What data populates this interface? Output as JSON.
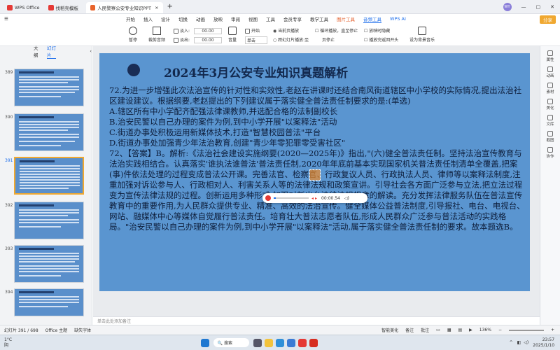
{
  "titlebar": {
    "tabs": [
      {
        "label": "WPS Office",
        "icon": "wps-logo-icon",
        "color": "#e53935"
      },
      {
        "label": "找稻壳模板",
        "icon": "docer-icon",
        "color": "#e53935"
      },
      {
        "label": "人民警察公安专业知识PPT1.p",
        "icon": "ppt-icon",
        "color": "#e8632b"
      }
    ],
    "user_initial": "WY"
  },
  "menubar": {
    "items": [
      "开始",
      "插入",
      "设计",
      "切换",
      "动画",
      "放映",
      "审阅",
      "视图",
      "工具",
      "会员专享",
      "教学工具",
      "图片工具",
      "音频工具"
    ],
    "selected": "音频工具",
    "wps_ai": "WPS AI",
    "share": "分享"
  },
  "ribbon": {
    "play": "播放",
    "pause": "暂停",
    "trim": "裁剪音频",
    "fade_in_label": "淡入:",
    "fade_in_value": "00.00",
    "fade_out_label": "淡出:",
    "fade_out_value": "00.00",
    "volume": "音量",
    "start_label": "开始",
    "start_value": "单击",
    "current_page": "当前页播放",
    "cross_slide": "跨幻灯片播放:至",
    "page_suffix": "页停止",
    "loop": "循环播放，直至停止",
    "hide_icon": "放映时隐藏",
    "rewind": "播放完返回开头",
    "bg_music": "设为背景音乐"
  },
  "sidebar": {
    "tabs": [
      "大纲",
      "幻灯片"
    ],
    "selected_tab": "幻灯片",
    "slides": [
      {
        "num": "389"
      },
      {
        "num": "390"
      },
      {
        "num": "391",
        "current": true
      },
      {
        "num": "392"
      },
      {
        "num": "393"
      },
      {
        "num": "394"
      }
    ]
  },
  "slide": {
    "title": "2024年3月公安专业知识真题解析",
    "lines": [
      "72.为进一步增强此次法治宣传的针对性和实效性,老赵在讲课时还结合南风街道辖区中小学校的实际情况,提出法治社区建设建议。根据纲要,老赵提出的下列建议属于落实健全普法责任制要求的是:(单选)",
      "A.辖区所有中小学配齐配强法律课教师,并选配合格的法制副校长",
      "B.治安民警以自己办理的案件为例,到中小学开展\"以案释法\"活动",
      "C.街道办事处积极运用新媒体技术,打造\"智慧校园普法\"平台",
      "D.街道办事处加强青少年法治教育,创建\"青少年零犯罪零受害社区\"",
      "72、【答案】B。解析:《法治社会建设实施纲要(2020—2025年)》指出,\"(六)健全普法责任制。坚持法治宣传教育与法治实践相结合。认真落实'谁执法谁普法'普法责任制,2020年年底前基本实现国家机关普法责任制清单全覆盖,把案(事)件依法处理的过程变成普法公开课。完善法官、检察官、行政复议人员、行政执法人员、律师等以案释法制度,注重加强对诉讼参与人、行政相对人、利害关系人等的法律法规和政策宣讲。引导社会各方面广泛参与立法,把立法过程变为宣传法律法规的过程。创新运用多种形式,加强对新出台法律法规规章的解读。充分发挥法律服务队伍在普法宣传教育中的重要作用,为人民群众提供专业、精准、高效的法治宣传。健全媒体公益普法制度,引导报社、电台、电视台、网站、融媒体中心等媒体自觉履行普法责任。培育壮大普法志愿者队伍,形成人民群众广泛参与普法活动的实践格局。\"治安民警以自己办理的案件为例,到中小学开展\"以案释法\"活动,属于落实健全普法责任制的要求。故本题选B。"
    ]
  },
  "player": {
    "time": "00:00.54"
  },
  "notes": {
    "placeholder": "单击此处添加备注"
  },
  "right_panel": {
    "items": [
      "属性",
      "动画",
      "素材",
      "美化",
      "文库",
      "截图",
      "协作"
    ]
  },
  "status": {
    "slide_counter": "幻灯片 391 / 698",
    "theme": "Office 主题",
    "missing_font": "缺失字体",
    "smart_beautify": "智能美化",
    "notes_btn": "备注",
    "comments_btn": "批注",
    "zoom": "136%"
  },
  "taskbar": {
    "weather_temp": "1°C",
    "weather_text": "阴",
    "search": "搜索",
    "time": "23:57",
    "date": "2025/1/10"
  },
  "colors": {
    "accent": "#1f6feb",
    "slide_bg": "#5a95d0",
    "title_dark": "#12284d"
  }
}
